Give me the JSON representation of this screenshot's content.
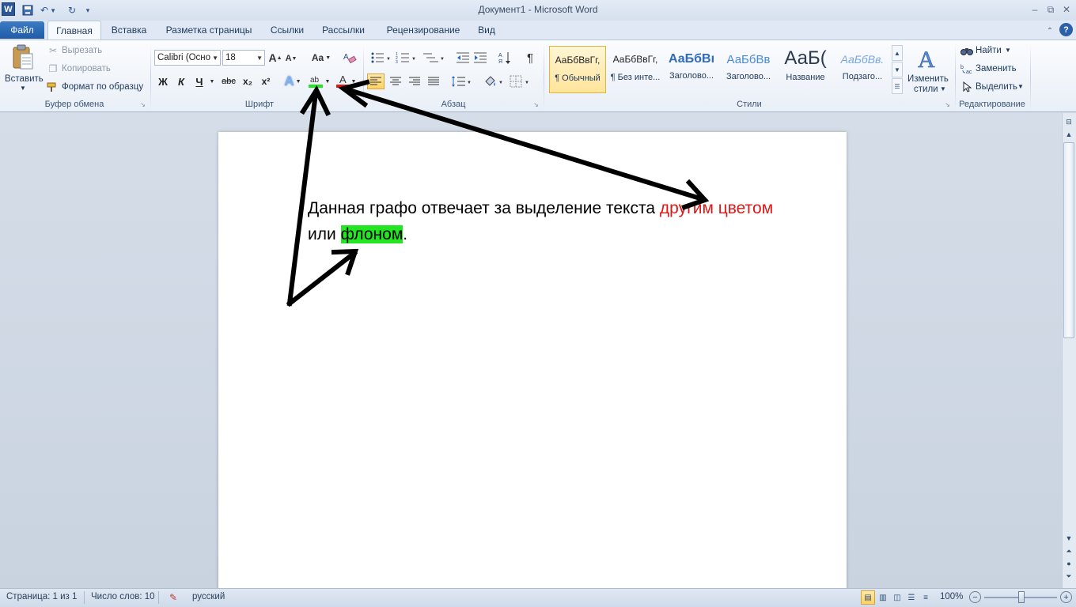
{
  "window": {
    "title": "Документ1 - Microsoft Word",
    "logo": "W",
    "controls": [
      "–",
      "⧉",
      "✕"
    ]
  },
  "tabs": {
    "file": "Файл",
    "items": [
      "Главная",
      "Вставка",
      "Разметка страницы",
      "Ссылки",
      "Рассылки",
      "Рецензирование",
      "Вид"
    ]
  },
  "clipboard": {
    "paste": "Вставить",
    "cut": "Вырезать",
    "copy": "Копировать",
    "format_painter": "Формат по образцу",
    "group": "Буфер обмена"
  },
  "font": {
    "name": "Calibri (Осно",
    "size": "18",
    "group": "Шрифт",
    "bold": "Ж",
    "italic": "К",
    "underline": "Ч",
    "strike": "abc",
    "subscript": "x₂",
    "superscript": "x²",
    "grow": "A",
    "shrink": "A",
    "case": "Aa",
    "text_effects": "A",
    "highlight": "ab",
    "font_color": "A",
    "highlight_color": "#22e622",
    "font_color_value": "#e01818"
  },
  "paragraph": {
    "group": "Абзац",
    "pilcrow": "¶"
  },
  "styles": {
    "group": "Стили",
    "items": [
      {
        "sample": "АаБбВвГг,",
        "name": "¶ Обычный"
      },
      {
        "sample": "АаБбВвГг,",
        "name": "¶ Без инте..."
      },
      {
        "sample": "АаБбВı",
        "name": "Заголово..."
      },
      {
        "sample": "АаБбВв",
        "name": "Заголово..."
      },
      {
        "sample": "АаБ(",
        "name": "Название"
      },
      {
        "sample": "АаБбВв.",
        "name": "Подзаго..."
      }
    ],
    "change_styles": "Изменить",
    "change_styles_2": "стили"
  },
  "editing": {
    "group": "Редактирование",
    "find": "Найти",
    "replace": "Заменить",
    "select": "Выделить"
  },
  "document": {
    "line1_plain": "Данная графо отвечает за выделение текста ",
    "line1_red": "другим цветом",
    "line2_plain": "или ",
    "line2_highlight": "флоном",
    "line2_end": "."
  },
  "status": {
    "page": "Страница: 1 из 1",
    "words": "Число слов: 10",
    "language": "русский",
    "zoom": "100%"
  }
}
